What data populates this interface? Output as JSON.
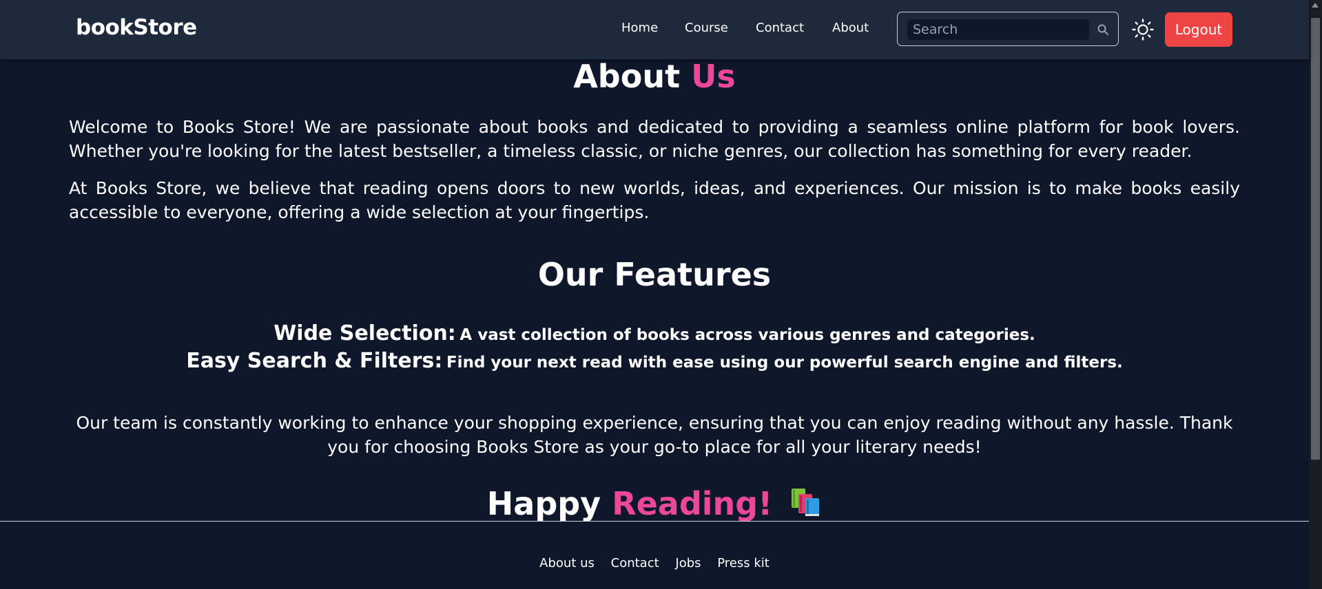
{
  "navbar": {
    "brand": "bookStore",
    "links": [
      {
        "label": "Home"
      },
      {
        "label": "Course"
      },
      {
        "label": "Contact"
      },
      {
        "label": "About"
      }
    ],
    "search": {
      "placeholder": "Search",
      "value": ""
    },
    "logout_label": "Logout",
    "theme_icon": "sun-icon"
  },
  "about": {
    "title_main": "About",
    "title_accent": "Us",
    "paragraphs": [
      "Welcome to Books Store! We are passionate about books and dedicated to providing a seamless online platform for book lovers. Whether you're looking for the latest bestseller, a timeless classic, or niche genres, our collection has something for every reader.",
      "At Books Store, we believe that reading opens doors to new worlds, ideas, and experiences. Our mission is to make books easily accessible to everyone, offering a wide selection at your fingertips."
    ]
  },
  "features": {
    "title": "Our Features",
    "items": [
      {
        "name": "Wide Selection:",
        "description": "A vast collection of books across various genres and categories."
      },
      {
        "name": "Easy Search & Filters:",
        "description": "Find your next read with ease using our powerful search engine and filters."
      }
    ]
  },
  "closing": {
    "text": "Our team is constantly working to enhance your shopping experience, ensuring that you can enjoy reading without any hassle. Thank you for choosing Books Store as your go-to place for all your literary needs!",
    "signoff_main": "Happy",
    "signoff_accent": "Reading!",
    "signoff_icon": "books-icon"
  },
  "footer": {
    "links": [
      {
        "label": "About us"
      },
      {
        "label": "Contact"
      },
      {
        "label": "Jobs"
      },
      {
        "label": "Press kit"
      }
    ]
  },
  "colors": {
    "page_background": "#0f172a",
    "navbar_background": "#1e293b",
    "accent": "#ec4899",
    "logout": "#ef4444"
  }
}
